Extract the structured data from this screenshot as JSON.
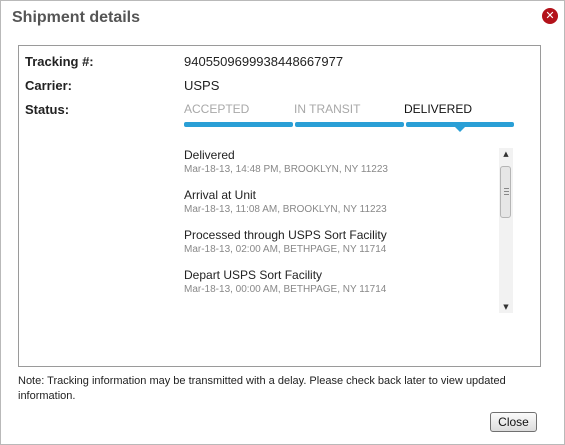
{
  "dialog": {
    "title": "Shipment details",
    "close_icon": "close-icon",
    "close_glyph": "✕"
  },
  "details": {
    "tracking_label": "Tracking #:",
    "tracking_value": "9405509699938448667977",
    "carrier_label": "Carrier:",
    "carrier_value": "USPS",
    "status_label": "Status:"
  },
  "status_steps": [
    {
      "label": "ACCEPTED",
      "active": false
    },
    {
      "label": "IN TRANSIT",
      "active": false
    },
    {
      "label": "DELIVERED",
      "active": true
    }
  ],
  "events": [
    {
      "title": "Delivered",
      "detail": "Mar-18-13, 14:48 PM, BROOKLYN, NY 11223"
    },
    {
      "title": "Arrival at Unit",
      "detail": "Mar-18-13, 11:08 AM, BROOKLYN, NY 11223"
    },
    {
      "title": "Processed through USPS Sort Facility",
      "detail": "Mar-18-13, 02:00 AM, BETHPAGE, NY 11714"
    },
    {
      "title": "Depart USPS Sort Facility",
      "detail": "Mar-18-13, 00:00 AM, BETHPAGE, NY 11714"
    }
  ],
  "scrollbar": {
    "up_glyph": "▲",
    "down_glyph": "▼"
  },
  "note": "Note: Tracking information may be transmitted with a delay. Please check back later to view updated information.",
  "footer": {
    "close_label": "Close"
  },
  "colors": {
    "accent": "#2a9fd6",
    "close_icon_bg": "#b3121a"
  }
}
